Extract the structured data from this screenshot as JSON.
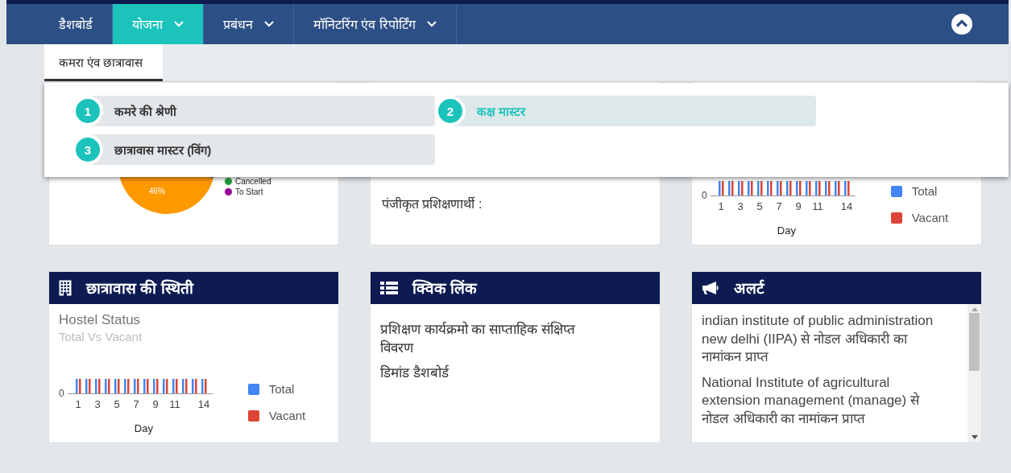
{
  "nav": {
    "items": [
      {
        "label": "डैशबोर्ड",
        "has_dropdown": false,
        "selected": false
      },
      {
        "label": "योजना",
        "has_dropdown": true,
        "selected": true
      },
      {
        "label": "प्रबंधन",
        "has_dropdown": true,
        "selected": false
      },
      {
        "label": "मॉनिटरिंग एंव रिपोर्टिंग",
        "has_dropdown": true,
        "selected": false
      }
    ]
  },
  "submenu": {
    "tabs": [
      {
        "label": "कमरा एंव छात्रावास",
        "selected": true
      }
    ],
    "items": [
      {
        "number": "1",
        "label": "कमरे की श्रेणी",
        "selected": false
      },
      {
        "number": "2",
        "label": "कक्ष मास्टर",
        "selected": true
      },
      {
        "number": "3",
        "label": "छात्रावास मास्टर (विंग)",
        "selected": false
      }
    ]
  },
  "top_cards": {
    "pie": {
      "slice_label": "46%",
      "legend": [
        {
          "label": "Cancelled",
          "color": "#1e9e3a"
        },
        {
          "label": "To Start",
          "color": "#990099"
        }
      ]
    },
    "registration": {
      "label": "पंजीकृत प्रशिक्षणार्थी :"
    },
    "chart": {
      "y_tick": "0",
      "x_tick_labels": [
        "1",
        "3",
        "5",
        "7",
        "9",
        "11",
        "14"
      ],
      "xlabel": "Day",
      "legend": [
        {
          "label": "Total",
          "color": "#4285f4"
        },
        {
          "label": "Vacant",
          "color": "#db4437"
        }
      ]
    }
  },
  "hostel_card": {
    "title": "छात्रावास की स्थिती",
    "chart_title": "Hostel Status",
    "chart_subtitle": "Total Vs Vacant",
    "chart": {
      "y_tick": "0",
      "x_tick_labels": [
        "1",
        "3",
        "5",
        "7",
        "9",
        "11",
        "14"
      ],
      "xlabel": "Day",
      "legend": [
        {
          "label": "Total",
          "color": "#4285f4"
        },
        {
          "label": "Vacant",
          "color": "#db4437"
        }
      ]
    }
  },
  "quick_links_card": {
    "title": "क्विक लिंक",
    "links": [
      "प्रशिक्षण कार्यक्रमो का साप्ताहिक संक्षिप्त विवरण",
      "डिमांड डैशबोर्ड"
    ]
  },
  "alerts_card": {
    "title": "अलर्ट",
    "alerts": [
      "indian institute of public administration new delhi (IIPA) से नोडल अधिकारी का नामांकन प्राप्त",
      "National Institute of agricultural extension management (manage) से नोडल अधिकारी का नामांकन प्राप्त"
    ]
  }
}
